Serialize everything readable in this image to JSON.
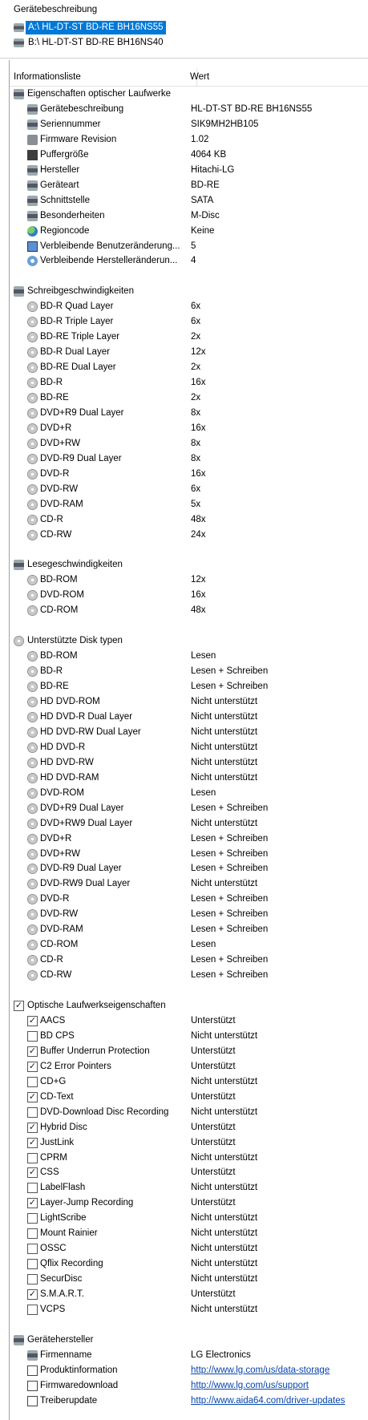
{
  "top": {
    "title": "Gerätebeschreibung",
    "devices": [
      "A:\\  HL-DT-ST BD-RE  BH16NS55",
      "B:\\  HL-DT-ST BD-RE  BH16NS40"
    ]
  },
  "columns": {
    "info": "Informationsliste",
    "value": "Wert"
  },
  "groups": [
    {
      "title": "Eigenschaften optischer Laufwerke",
      "icon": "drive-icon",
      "items": [
        {
          "k": "Gerätebeschreibung",
          "v": "HL-DT-ST BD-RE  BH16NS55",
          "icon": "drive-icon"
        },
        {
          "k": "Seriennummer",
          "v": "SIK9MH2HB105",
          "icon": "drive-icon"
        },
        {
          "k": "Firmware Revision",
          "v": "1.02",
          "icon": "chip-icon"
        },
        {
          "k": "Puffergröße",
          "v": "4064 KB",
          "icon": "memory-icon"
        },
        {
          "k": "Hersteller",
          "v": "Hitachi-LG",
          "icon": "drive-icon"
        },
        {
          "k": "Geräteart",
          "v": "BD-RE",
          "icon": "drive-icon"
        },
        {
          "k": "Schnittstelle",
          "v": "SATA",
          "icon": "drive-icon"
        },
        {
          "k": "Besonderheiten",
          "v": "M-Disc",
          "icon": "drive-icon"
        },
        {
          "k": "Regioncode",
          "v": "Keine",
          "icon": "globe-icon"
        },
        {
          "k": "Verbleibende Benutzeränderung...",
          "v": "5",
          "icon": "monitor-icon"
        },
        {
          "k": "Verbleibende Herstelleränderun...",
          "v": "4",
          "icon": "gear-icon"
        }
      ]
    },
    {
      "title": "Schreibgeschwindigkeiten",
      "icon": "drive-icon",
      "items": [
        {
          "k": "BD-R Quad Layer",
          "v": "6x",
          "icon": "disc-icon"
        },
        {
          "k": "BD-R Triple Layer",
          "v": "6x",
          "icon": "disc-icon"
        },
        {
          "k": "BD-RE Triple Layer",
          "v": "2x",
          "icon": "disc-icon"
        },
        {
          "k": "BD-R Dual Layer",
          "v": "12x",
          "icon": "disc-icon"
        },
        {
          "k": "BD-RE Dual Layer",
          "v": "2x",
          "icon": "disc-icon"
        },
        {
          "k": "BD-R",
          "v": "16x",
          "icon": "disc-icon"
        },
        {
          "k": "BD-RE",
          "v": "2x",
          "icon": "disc-icon"
        },
        {
          "k": "DVD+R9 Dual Layer",
          "v": "8x",
          "icon": "disc-icon"
        },
        {
          "k": "DVD+R",
          "v": "16x",
          "icon": "disc-icon"
        },
        {
          "k": "DVD+RW",
          "v": "8x",
          "icon": "disc-icon"
        },
        {
          "k": "DVD-R9 Dual Layer",
          "v": "8x",
          "icon": "disc-icon"
        },
        {
          "k": "DVD-R",
          "v": "16x",
          "icon": "disc-icon"
        },
        {
          "k": "DVD-RW",
          "v": "6x",
          "icon": "disc-icon"
        },
        {
          "k": "DVD-RAM",
          "v": "5x",
          "icon": "disc-icon"
        },
        {
          "k": "CD-R",
          "v": "48x",
          "icon": "disc-icon"
        },
        {
          "k": "CD-RW",
          "v": "24x",
          "icon": "disc-icon"
        }
      ]
    },
    {
      "title": "Lesegeschwindigkeiten",
      "icon": "drive-icon",
      "items": [
        {
          "k": "BD-ROM",
          "v": "12x",
          "icon": "disc-icon"
        },
        {
          "k": "DVD-ROM",
          "v": "16x",
          "icon": "disc-icon"
        },
        {
          "k": "CD-ROM",
          "v": "48x",
          "icon": "disc-icon"
        }
      ]
    },
    {
      "title": "Unterstützte Disk typen",
      "icon": "disc-icon",
      "items": [
        {
          "k": "BD-ROM",
          "v": "Lesen",
          "icon": "disc-icon"
        },
        {
          "k": "BD-R",
          "v": "Lesen + Schreiben",
          "icon": "disc-icon"
        },
        {
          "k": "BD-RE",
          "v": "Lesen + Schreiben",
          "icon": "disc-icon"
        },
        {
          "k": "HD DVD-ROM",
          "v": "Nicht unterstützt",
          "icon": "disc-icon"
        },
        {
          "k": "HD DVD-R Dual Layer",
          "v": "Nicht unterstützt",
          "icon": "disc-icon"
        },
        {
          "k": "HD DVD-RW Dual Layer",
          "v": "Nicht unterstützt",
          "icon": "disc-icon"
        },
        {
          "k": "HD DVD-R",
          "v": "Nicht unterstützt",
          "icon": "disc-icon"
        },
        {
          "k": "HD DVD-RW",
          "v": "Nicht unterstützt",
          "icon": "disc-icon"
        },
        {
          "k": "HD DVD-RAM",
          "v": "Nicht unterstützt",
          "icon": "disc-icon"
        },
        {
          "k": "DVD-ROM",
          "v": "Lesen",
          "icon": "disc-icon"
        },
        {
          "k": "DVD+R9 Dual Layer",
          "v": "Lesen + Schreiben",
          "icon": "disc-icon"
        },
        {
          "k": "DVD+RW9 Dual Layer",
          "v": "Nicht unterstützt",
          "icon": "disc-icon"
        },
        {
          "k": "DVD+R",
          "v": "Lesen + Schreiben",
          "icon": "disc-icon"
        },
        {
          "k": "DVD+RW",
          "v": "Lesen + Schreiben",
          "icon": "disc-icon"
        },
        {
          "k": "DVD-R9 Dual Layer",
          "v": "Lesen + Schreiben",
          "icon": "disc-icon"
        },
        {
          "k": "DVD-RW9 Dual Layer",
          "v": "Nicht unterstützt",
          "icon": "disc-icon"
        },
        {
          "k": "DVD-R",
          "v": "Lesen + Schreiben",
          "icon": "disc-icon"
        },
        {
          "k": "DVD-RW",
          "v": "Lesen + Schreiben",
          "icon": "disc-icon"
        },
        {
          "k": "DVD-RAM",
          "v": "Lesen + Schreiben",
          "icon": "disc-icon"
        },
        {
          "k": "CD-ROM",
          "v": "Lesen",
          "icon": "disc-icon"
        },
        {
          "k": "CD-R",
          "v": "Lesen + Schreiben",
          "icon": "disc-icon"
        },
        {
          "k": "CD-RW",
          "v": "Lesen + Schreiben",
          "icon": "disc-icon"
        }
      ]
    },
    {
      "title": "Optische Laufwerkseigenschaften",
      "icon": "checkbox-icon",
      "items": [
        {
          "k": "AACS",
          "v": "Unterstützt",
          "icon": "checkbox-icon",
          "checked": true
        },
        {
          "k": "BD CPS",
          "v": "Nicht unterstützt",
          "icon": "checkbox-icon",
          "checked": false
        },
        {
          "k": "Buffer Underrun Protection",
          "v": "Unterstützt",
          "icon": "checkbox-icon",
          "checked": true
        },
        {
          "k": "C2 Error Pointers",
          "v": "Unterstützt",
          "icon": "checkbox-icon",
          "checked": true
        },
        {
          "k": "CD+G",
          "v": "Nicht unterstützt",
          "icon": "checkbox-icon",
          "checked": false
        },
        {
          "k": "CD-Text",
          "v": "Unterstützt",
          "icon": "checkbox-icon",
          "checked": true
        },
        {
          "k": "DVD-Download Disc Recording",
          "v": "Nicht unterstützt",
          "icon": "checkbox-icon",
          "checked": false
        },
        {
          "k": "Hybrid Disc",
          "v": "Unterstützt",
          "icon": "checkbox-icon",
          "checked": true
        },
        {
          "k": "JustLink",
          "v": "Unterstützt",
          "icon": "checkbox-icon",
          "checked": true
        },
        {
          "k": "CPRM",
          "v": "Nicht unterstützt",
          "icon": "checkbox-icon",
          "checked": false
        },
        {
          "k": "CSS",
          "v": "Unterstützt",
          "icon": "checkbox-icon",
          "checked": true
        },
        {
          "k": "LabelFlash",
          "v": "Nicht unterstützt",
          "icon": "checkbox-icon",
          "checked": false
        },
        {
          "k": "Layer-Jump Recording",
          "v": "Unterstützt",
          "icon": "checkbox-icon",
          "checked": true
        },
        {
          "k": "LightScribe",
          "v": "Nicht unterstützt",
          "icon": "checkbox-icon",
          "checked": false
        },
        {
          "k": "Mount Rainier",
          "v": "Nicht unterstützt",
          "icon": "checkbox-icon",
          "checked": false
        },
        {
          "k": "OSSC",
          "v": "Nicht unterstützt",
          "icon": "checkbox-icon",
          "checked": false
        },
        {
          "k": "Qflix Recording",
          "v": "Nicht unterstützt",
          "icon": "checkbox-icon",
          "checked": false
        },
        {
          "k": "SecurDisc",
          "v": "Nicht unterstützt",
          "icon": "checkbox-icon",
          "checked": false
        },
        {
          "k": "S.M.A.R.T.",
          "v": "Unterstützt",
          "icon": "checkbox-icon",
          "checked": true
        },
        {
          "k": "VCPS",
          "v": "Nicht unterstützt",
          "icon": "checkbox-icon",
          "checked": false
        }
      ]
    },
    {
      "title": "Gerätehersteller",
      "icon": "drive-icon",
      "items": [
        {
          "k": "Firmenname",
          "v": "LG Electronics",
          "icon": "drive-icon"
        },
        {
          "k": "Produktinformation",
          "v": "http://www.lg.com/us/data-storage",
          "icon": "link-icon",
          "link": true
        },
        {
          "k": "Firmwaredownload",
          "v": "http://www.lg.com/us/support",
          "icon": "link-icon",
          "link": true
        },
        {
          "k": "Treiberupdate",
          "v": "http://www.aida64.com/driver-updates",
          "icon": "link-icon",
          "link": true
        }
      ]
    }
  ]
}
